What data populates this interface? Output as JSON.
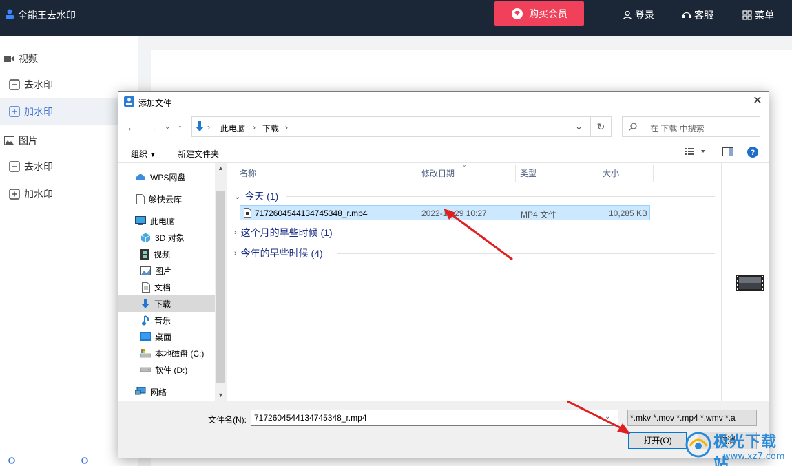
{
  "app": {
    "title": "全能王去水印",
    "vip_label": "购买会员",
    "login_label": "登录",
    "service_label": "客服",
    "menu_label": "菜单"
  },
  "sidebar": {
    "video_group": "视频",
    "video_remove": "去水印",
    "video_add": "加水印",
    "image_group": "图片",
    "image_remove": "去水印",
    "image_add": "加水印"
  },
  "dialog": {
    "title": "添加文件",
    "breadcrumb": [
      "此电脑",
      "下载"
    ],
    "search_placeholder": "在 下载 中搜索",
    "toolbar": {
      "organize": "组织",
      "new_folder": "新建文件夹"
    },
    "nav_items": [
      "WPS网盘",
      "够快云库",
      "此电脑",
      "3D 对象",
      "视频",
      "图片",
      "文档",
      "下载",
      "音乐",
      "桌面",
      "本地磁盘 (C:)",
      "软件 (D:)",
      "网络"
    ],
    "columns": {
      "name": "名称",
      "modified": "修改日期",
      "type": "类型",
      "size": "大小"
    },
    "groups": [
      {
        "label": "今天 (1)"
      },
      {
        "label": "这个月的早些时候 (1)"
      },
      {
        "label": "今年的早些时候 (4)"
      }
    ],
    "file": {
      "name": "7172604544134745348_r.mp4",
      "modified": "2022-12-29 10:27",
      "type": "MP4 文件",
      "size": "10,285 KB"
    },
    "filename_label": "文件名(N):",
    "filename_value": "7172604544134745348_r.mp4",
    "filetype_value": "*.mkv *.mov *.mp4 *.wmv *.a",
    "open_label": "打开(O)",
    "cancel_label": "取消"
  },
  "watermark": {
    "brand": "极光下载站",
    "url": "www.xz7.com"
  },
  "colors": {
    "header_bg": "#1b2637",
    "vip_red": "#f0405a",
    "selection": "#cce8ff",
    "arrow": "#e02020"
  }
}
